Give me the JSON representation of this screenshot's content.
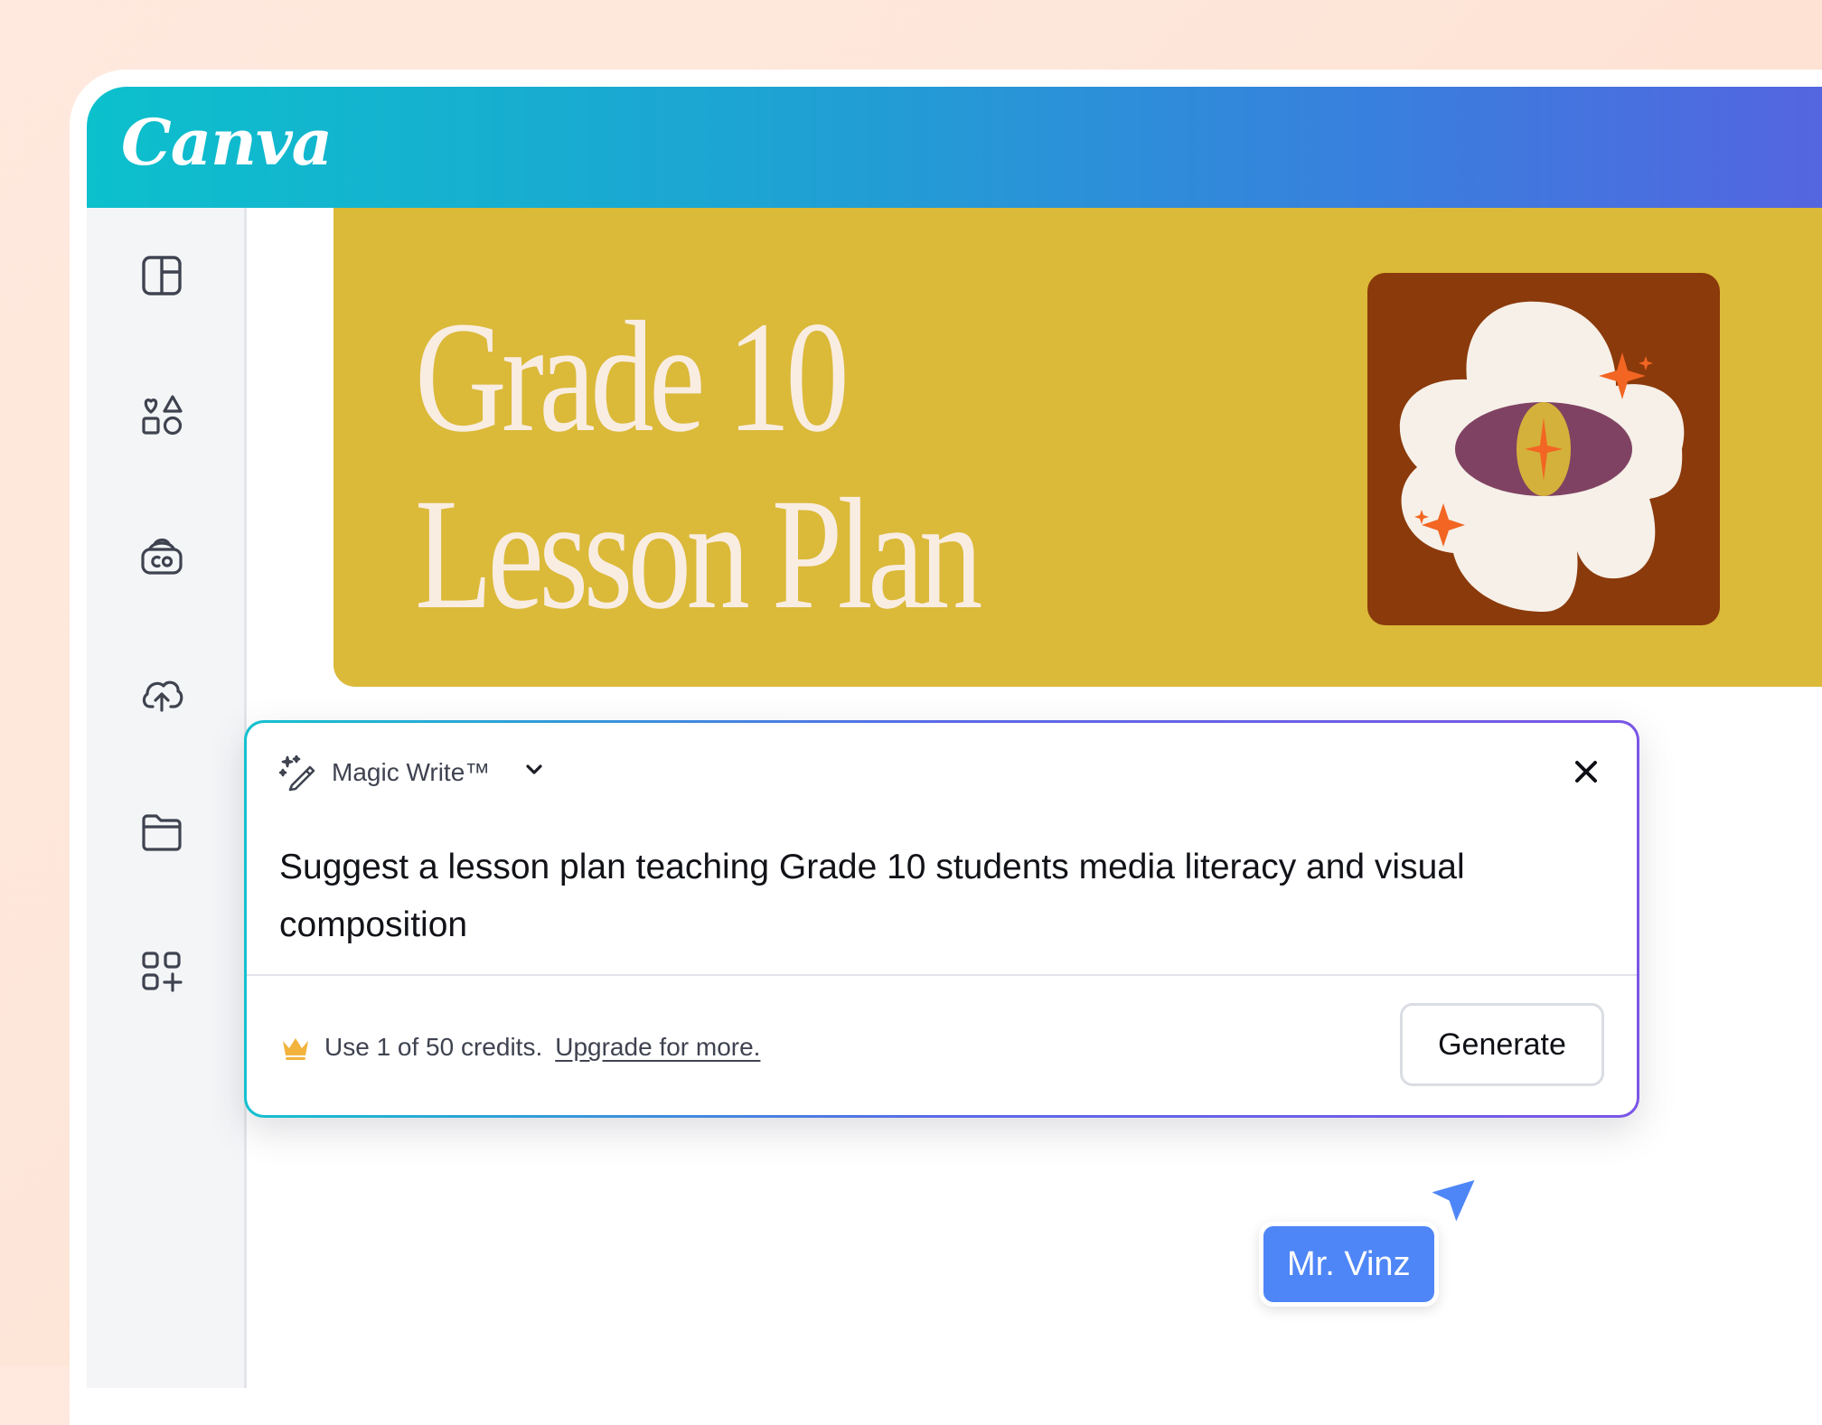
{
  "app": {
    "logo_text": "Canva",
    "header_gradient": [
      "#0cc0cc",
      "#5564e0"
    ]
  },
  "sidebar": {
    "items": [
      {
        "icon": "layout-icon"
      },
      {
        "icon": "elements-icon"
      },
      {
        "icon": "brand-icon"
      },
      {
        "icon": "upload-cloud-icon"
      },
      {
        "icon": "folder-icon"
      },
      {
        "icon": "apps-icon"
      }
    ]
  },
  "design": {
    "title_line1": "Grade 10",
    "title_line2": "Lesson Plan",
    "banner_color": "#dbb939",
    "card_color": "#8b3a0b"
  },
  "magic_write": {
    "label": "Magic Write™",
    "prompt": "Suggest a lesson plan teaching Grade 10 students media literacy and visual composition",
    "credits_text": "Use 1 of 50 credits.",
    "upgrade_link": "Upgrade for more.",
    "generate_label": "Generate"
  },
  "collaborator": {
    "name": "Mr. Vinz",
    "color": "#4f86f7"
  }
}
